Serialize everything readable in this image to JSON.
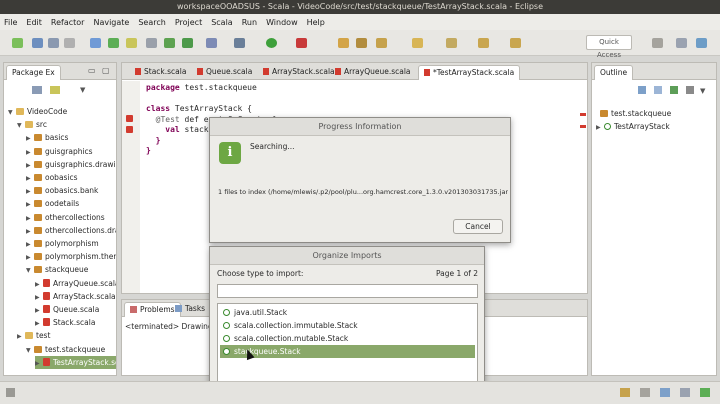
{
  "window": {
    "title": "workspaceOOADSUS - Scala - VideoCode/src/test/stackqueue/TestArrayStack.scala - Eclipse"
  },
  "menu": [
    "File",
    "Edit",
    "Refactor",
    "Navigate",
    "Search",
    "Project",
    "Scala",
    "Run",
    "Window",
    "Help"
  ],
  "toolbar": {
    "quick_access": "Quick Access"
  },
  "package_explorer": {
    "tab": "Package Ex",
    "items": [
      {
        "label": "VideoCode",
        "kind": "project",
        "depth": 0,
        "expanded": true
      },
      {
        "label": "src",
        "kind": "folder",
        "depth": 1,
        "expanded": true
      },
      {
        "label": "basics",
        "kind": "package",
        "depth": 2
      },
      {
        "label": "guisgraphics",
        "kind": "package",
        "depth": 2
      },
      {
        "label": "guisgraphics.drawing",
        "kind": "package",
        "depth": 2
      },
      {
        "label": "oobasics",
        "kind": "package",
        "depth": 2
      },
      {
        "label": "oobasics.bank",
        "kind": "package",
        "depth": 2
      },
      {
        "label": "oodetails",
        "kind": "package",
        "depth": 2
      },
      {
        "label": "othercollections",
        "kind": "package",
        "depth": 2
      },
      {
        "label": "othercollections.drawi",
        "kind": "package",
        "depth": 2
      },
      {
        "label": "polymorphism",
        "kind": "package",
        "depth": 2
      },
      {
        "label": "polymorphism.themep",
        "kind": "package",
        "depth": 2
      },
      {
        "label": "stackqueue",
        "kind": "package",
        "depth": 2,
        "expanded": true
      },
      {
        "label": "ArrayQueue.scala",
        "kind": "file",
        "depth": 3
      },
      {
        "label": "ArrayStack.scala",
        "kind": "file",
        "depth": 3
      },
      {
        "label": "Queue.scala",
        "kind": "file",
        "depth": 3
      },
      {
        "label": "Stack.scala",
        "kind": "file",
        "depth": 3
      },
      {
        "label": "test",
        "kind": "folder",
        "depth": 1
      },
      {
        "label": "test.stackqueue",
        "kind": "package",
        "depth": 2,
        "expanded": true
      },
      {
        "label": "TestArrayStack.scal",
        "kind": "file",
        "depth": 3,
        "selected": true
      }
    ]
  },
  "editor": {
    "tabs": [
      "Stack.scala",
      "Queue.scala",
      "ArrayStack.scala",
      "ArrayQueue.scala",
      "*TestArrayStack.scala"
    ],
    "lines": [
      [
        "package",
        " test.stackqueue"
      ],
      [
        "",
        ""
      ],
      [
        "class",
        " TestArrayStack {"
      ],
      [
        "  @Test",
        " def emptyOnCreate {"
      ],
      [
        "    val",
        " stack"
      ],
      [
        "  }",
        ""
      ],
      [
        "}",
        ""
      ]
    ]
  },
  "outline": {
    "tab": "Outline",
    "items": [
      "test.stackqueue",
      "TestArrayStack"
    ]
  },
  "bottom": {
    "tabs": [
      "Problems",
      "Tasks"
    ],
    "console_text": "<terminated> DrawingMai"
  },
  "progress_dialog": {
    "title": "Progress Information",
    "message": "Searching...",
    "detail": "1 files to index (/home/mlewis/.p2/pool/plu...org.hamcrest.core_1.3.0.v201303031735.jar)",
    "cancel": "Cancel"
  },
  "organize_dialog": {
    "title": "Organize Imports",
    "prompt": "Choose type to import:",
    "page": "Page 1 of 2",
    "filter_value": "",
    "options": [
      "java.util.Stack",
      "scala.collection.immutable.Stack",
      "scala.collection.mutable.Stack",
      "stackqueue.Stack"
    ],
    "selected_index": 3
  },
  "colors": {
    "selection": "#8aa86a",
    "titlebar": "#3c3b37",
    "error": "#d23b2f"
  }
}
